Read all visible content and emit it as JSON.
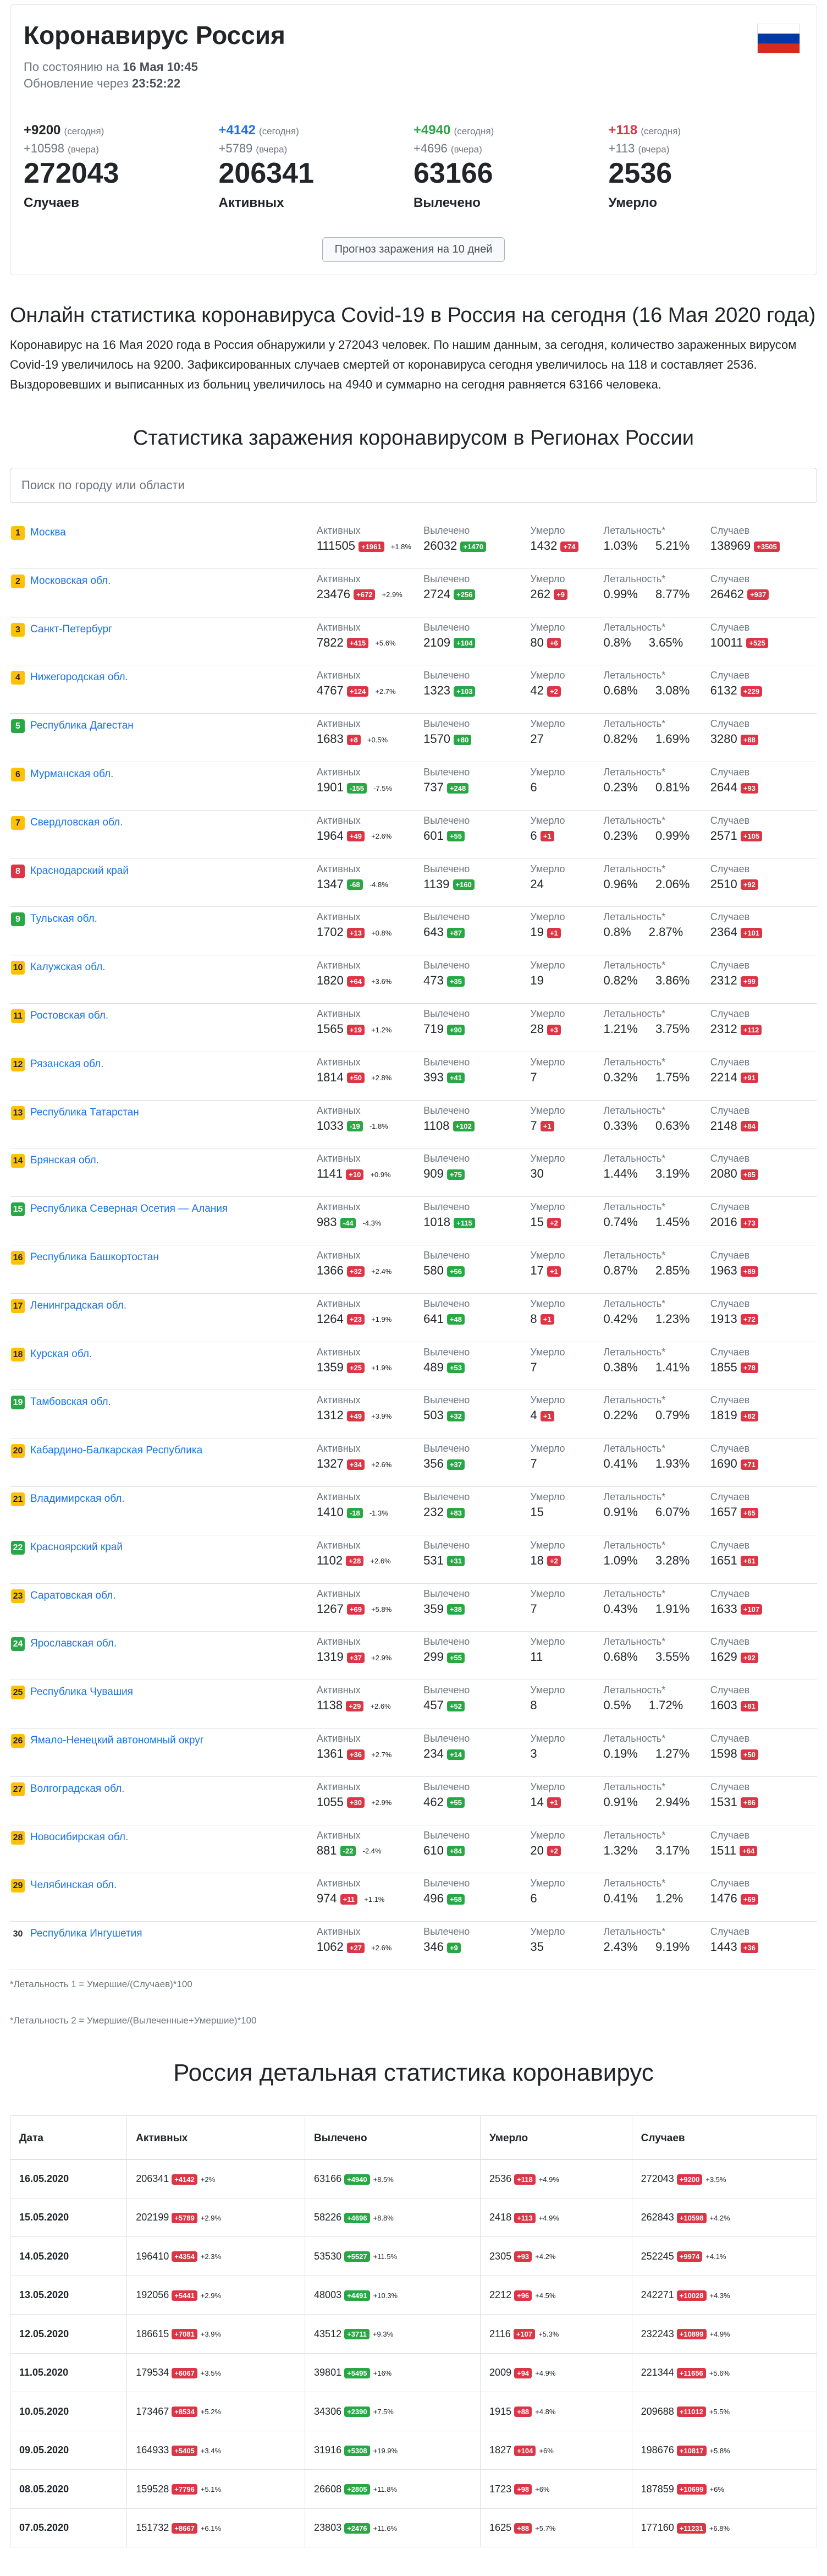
{
  "header": {
    "title": "Коронавирус Россия",
    "as_of_prefix": "По состоянию на",
    "as_of_value": "16 Мая 10:45",
    "update_prefix": "Обновление через",
    "update_value": "23:52:22"
  },
  "summary": [
    {
      "today": "+9200",
      "today_note": "(сегодня)",
      "yest": "+10598",
      "yest_note": "(вчера)",
      "total": "272043",
      "label": "Случаев",
      "color": "#212529"
    },
    {
      "today": "+4142",
      "today_note": "(сегодня)",
      "yest": "+5789",
      "yest_note": "(вчера)",
      "total": "206341",
      "label": "Активных",
      "color": "#1a73e8"
    },
    {
      "today": "+4940",
      "today_note": "(сегодня)",
      "yest": "+4696",
      "yest_note": "(вчера)",
      "total": "63166",
      "label": "Вылечено",
      "color": "#28a745"
    },
    {
      "today": "+118",
      "today_note": "(сегодня)",
      "yest": "+113",
      "yest_note": "(вчера)",
      "total": "2536",
      "label": "Умерло",
      "color": "#dc3545"
    }
  ],
  "forecast_button": "Прогноз заражения на 10 дней",
  "online_title": "Онлайн статистика коронавируса Covid-19 в Россия на сегодня (16 Мая 2020 года)",
  "online_desc": "Коронавирус на 16 Мая 2020 года в Россия обнаружили у 272043 человек. По нашим данным, за сегодня, количество зараженных вирусом Covid-19 увеличилось на 9200. Зафиксированных случаев смертей от коронавируса сегодня увеличилось на 118 и составляет 2536. Выздоровевших и выписанных из больниц увеличилось на 4940 и суммарно на сегодня равняется 63166 человека.",
  "regions_title": "Статистика заражения коронавирусом в Регионах России",
  "search_placeholder": "Поиск по городу или области",
  "col_labels": {
    "active": "Активных",
    "recovered": "Вылечено",
    "died": "Умерло",
    "lethality": "Летальность*",
    "cases": "Случаев"
  },
  "regions": [
    {
      "rank": "1",
      "rc": "y",
      "name": "Москва",
      "active": "111505",
      "ad": "+1961",
      "ap": "+1.8%",
      "rec": "26032",
      "recd": "+1470",
      "died": "1432",
      "dd": "+74",
      "l1": "1.03%",
      "l2": "5.21%",
      "cases": "138969",
      "cd": "+3505"
    },
    {
      "rank": "2",
      "rc": "y",
      "name": "Московская обл.",
      "active": "23476",
      "ad": "+672",
      "ap": "+2.9%",
      "rec": "2724",
      "recd": "+256",
      "died": "262",
      "dd": "+9",
      "l1": "0.99%",
      "l2": "8.77%",
      "cases": "26462",
      "cd": "+937"
    },
    {
      "rank": "3",
      "rc": "y",
      "name": "Санкт-Петербург",
      "active": "7822",
      "ad": "+415",
      "ap": "+5.6%",
      "rec": "2109",
      "recd": "+104",
      "died": "80",
      "dd": "+6",
      "l1": "0.8%",
      "l2": "3.65%",
      "cases": "10011",
      "cd": "+525"
    },
    {
      "rank": "4",
      "rc": "y",
      "name": "Нижегородская обл.",
      "active": "4767",
      "ad": "+124",
      "ap": "+2.7%",
      "rec": "1323",
      "recd": "+103",
      "died": "42",
      "dd": "+2",
      "l1": "0.68%",
      "l2": "3.08%",
      "cases": "6132",
      "cd": "+229"
    },
    {
      "rank": "5",
      "rc": "g",
      "name": "Республика Дагестан",
      "active": "1683",
      "ad": "+8",
      "ap": "+0.5%",
      "rec": "1570",
      "recd": "+80",
      "died": "27",
      "dd": "",
      "l1": "0.82%",
      "l2": "1.69%",
      "cases": "3280",
      "cd": "+88"
    },
    {
      "rank": "6",
      "rc": "y",
      "name": "Мурманская обл.",
      "active": "1901",
      "ad": "-155",
      "ap": "-7.5%",
      "rec": "737",
      "recd": "+248",
      "died": "6",
      "dd": "",
      "l1": "0.23%",
      "l2": "0.81%",
      "cases": "2644",
      "cd": "+93"
    },
    {
      "rank": "7",
      "rc": "y",
      "name": "Свердловская обл.",
      "active": "1964",
      "ad": "+49",
      "ap": "+2.6%",
      "rec": "601",
      "recd": "+55",
      "died": "6",
      "dd": "+1",
      "l1": "0.23%",
      "l2": "0.99%",
      "cases": "2571",
      "cd": "+105"
    },
    {
      "rank": "8",
      "rc": "r",
      "name": "Краснодарский край",
      "active": "1347",
      "ad": "-68",
      "ap": "-4.8%",
      "rec": "1139",
      "recd": "+160",
      "died": "24",
      "dd": "",
      "l1": "0.96%",
      "l2": "2.06%",
      "cases": "2510",
      "cd": "+92"
    },
    {
      "rank": "9",
      "rc": "g",
      "name": "Тульская обл.",
      "active": "1702",
      "ad": "+13",
      "ap": "+0.8%",
      "rec": "643",
      "recd": "+87",
      "died": "19",
      "dd": "+1",
      "l1": "0.8%",
      "l2": "2.87%",
      "cases": "2364",
      "cd": "+101"
    },
    {
      "rank": "10",
      "rc": "y",
      "name": "Калужская обл.",
      "active": "1820",
      "ad": "+64",
      "ap": "+3.6%",
      "rec": "473",
      "recd": "+35",
      "died": "19",
      "dd": "",
      "l1": "0.82%",
      "l2": "3.86%",
      "cases": "2312",
      "cd": "+99"
    },
    {
      "rank": "11",
      "rc": "y",
      "name": "Ростовская обл.",
      "active": "1565",
      "ad": "+19",
      "ap": "+1.2%",
      "rec": "719",
      "recd": "+90",
      "died": "28",
      "dd": "+3",
      "l1": "1.21%",
      "l2": "3.75%",
      "cases": "2312",
      "cd": "+112"
    },
    {
      "rank": "12",
      "rc": "y",
      "name": "Рязанская обл.",
      "active": "1814",
      "ad": "+50",
      "ap": "+2.8%",
      "rec": "393",
      "recd": "+41",
      "died": "7",
      "dd": "",
      "l1": "0.32%",
      "l2": "1.75%",
      "cases": "2214",
      "cd": "+91"
    },
    {
      "rank": "13",
      "rc": "y",
      "name": "Республика Татарстан",
      "active": "1033",
      "ad": "-19",
      "ap": "-1.8%",
      "rec": "1108",
      "recd": "+102",
      "died": "7",
      "dd": "+1",
      "l1": "0.33%",
      "l2": "0.63%",
      "cases": "2148",
      "cd": "+84"
    },
    {
      "rank": "14",
      "rc": "y",
      "name": "Брянская обл.",
      "active": "1141",
      "ad": "+10",
      "ap": "+0.9%",
      "rec": "909",
      "recd": "+75",
      "died": "30",
      "dd": "",
      "l1": "1.44%",
      "l2": "3.19%",
      "cases": "2080",
      "cd": "+85"
    },
    {
      "rank": "15",
      "rc": "g",
      "name": "Республика Северная Осетия — Алания",
      "active": "983",
      "ad": "-44",
      "ap": "-4.3%",
      "rec": "1018",
      "recd": "+115",
      "died": "15",
      "dd": "+2",
      "l1": "0.74%",
      "l2": "1.45%",
      "cases": "2016",
      "cd": "+73"
    },
    {
      "rank": "16",
      "rc": "y",
      "name": "Республика Башкортостан",
      "active": "1366",
      "ad": "+32",
      "ap": "+2.4%",
      "rec": "580",
      "recd": "+56",
      "died": "17",
      "dd": "+1",
      "l1": "0.87%",
      "l2": "2.85%",
      "cases": "1963",
      "cd": "+89"
    },
    {
      "rank": "17",
      "rc": "y",
      "name": "Ленинградская обл.",
      "active": "1264",
      "ad": "+23",
      "ap": "+1.9%",
      "rec": "641",
      "recd": "+48",
      "died": "8",
      "dd": "+1",
      "l1": "0.42%",
      "l2": "1.23%",
      "cases": "1913",
      "cd": "+72"
    },
    {
      "rank": "18",
      "rc": "y",
      "name": "Курская обл.",
      "active": "1359",
      "ad": "+25",
      "ap": "+1.9%",
      "rec": "489",
      "recd": "+53",
      "died": "7",
      "dd": "",
      "l1": "0.38%",
      "l2": "1.41%",
      "cases": "1855",
      "cd": "+78"
    },
    {
      "rank": "19",
      "rc": "g",
      "name": "Тамбовская обл.",
      "active": "1312",
      "ad": "+49",
      "ap": "+3.9%",
      "rec": "503",
      "recd": "+32",
      "died": "4",
      "dd": "+1",
      "l1": "0.22%",
      "l2": "0.79%",
      "cases": "1819",
      "cd": "+82"
    },
    {
      "rank": "20",
      "rc": "y",
      "name": "Кабардино-Балкарская Республика",
      "active": "1327",
      "ad": "+34",
      "ap": "+2.6%",
      "rec": "356",
      "recd": "+37",
      "died": "7",
      "dd": "",
      "l1": "0.41%",
      "l2": "1.93%",
      "cases": "1690",
      "cd": "+71"
    },
    {
      "rank": "21",
      "rc": "y",
      "name": "Владимирская обл.",
      "active": "1410",
      "ad": "-18",
      "ap": "-1.3%",
      "rec": "232",
      "recd": "+83",
      "died": "15",
      "dd": "",
      "l1": "0.91%",
      "l2": "6.07%",
      "cases": "1657",
      "cd": "+65"
    },
    {
      "rank": "22",
      "rc": "g",
      "name": "Красноярский край",
      "active": "1102",
      "ad": "+28",
      "ap": "+2.6%",
      "rec": "531",
      "recd": "+31",
      "died": "18",
      "dd": "+2",
      "l1": "1.09%",
      "l2": "3.28%",
      "cases": "1651",
      "cd": "+61"
    },
    {
      "rank": "23",
      "rc": "y",
      "name": "Саратовская обл.",
      "active": "1267",
      "ad": "+69",
      "ap": "+5.8%",
      "rec": "359",
      "recd": "+38",
      "died": "7",
      "dd": "",
      "l1": "0.43%",
      "l2": "1.91%",
      "cases": "1633",
      "cd": "+107"
    },
    {
      "rank": "24",
      "rc": "g",
      "name": "Ярославская обл.",
      "active": "1319",
      "ad": "+37",
      "ap": "+2.9%",
      "rec": "299",
      "recd": "+55",
      "died": "11",
      "dd": "",
      "l1": "0.68%",
      "l2": "3.55%",
      "cases": "1629",
      "cd": "+92"
    },
    {
      "rank": "25",
      "rc": "y",
      "name": "Республика Чувашия",
      "active": "1138",
      "ad": "+29",
      "ap": "+2.6%",
      "rec": "457",
      "recd": "+52",
      "died": "8",
      "dd": "",
      "l1": "0.5%",
      "l2": "1.72%",
      "cases": "1603",
      "cd": "+81"
    },
    {
      "rank": "26",
      "rc": "y",
      "name": "Ямало-Ненецкий автономный округ",
      "active": "1361",
      "ad": "+36",
      "ap": "+2.7%",
      "rec": "234",
      "recd": "+14",
      "died": "3",
      "dd": "",
      "l1": "0.19%",
      "l2": "1.27%",
      "cases": "1598",
      "cd": "+50"
    },
    {
      "rank": "27",
      "rc": "y",
      "name": "Волгоградская обл.",
      "active": "1055",
      "ad": "+30",
      "ap": "+2.9%",
      "rec": "462",
      "recd": "+55",
      "died": "14",
      "dd": "+1",
      "l1": "0.91%",
      "l2": "2.94%",
      "cases": "1531",
      "cd": "+86"
    },
    {
      "rank": "28",
      "rc": "y",
      "name": "Новосибирская обл.",
      "active": "881",
      "ad": "-22",
      "ap": "-2.4%",
      "rec": "610",
      "recd": "+84",
      "died": "20",
      "dd": "+2",
      "l1": "1.32%",
      "l2": "3.17%",
      "cases": "1511",
      "cd": "+64"
    },
    {
      "rank": "29",
      "rc": "y",
      "name": "Челябинская обл.",
      "active": "974",
      "ad": "+11",
      "ap": "+1.1%",
      "rec": "496",
      "recd": "+58",
      "died": "6",
      "dd": "",
      "l1": "0.41%",
      "l2": "1.2%",
      "cases": "1476",
      "cd": "+69"
    },
    {
      "rank": "30",
      "rc": "n",
      "name": "Республика Ингушетия",
      "active": "1062",
      "ad": "+27",
      "ap": "+2.6%",
      "rec": "346",
      "recd": "+9",
      "died": "35",
      "dd": "",
      "l1": "2.43%",
      "l2": "9.19%",
      "cases": "1443",
      "cd": "+36"
    }
  ],
  "note1": "*Летальность 1 = Умершие/(Случаев)*100",
  "note2": "*Летальность 2 = Умершие/(Вылеченные+Умершие)*100",
  "detail_title": "Россия детальная статистика коронавирус",
  "detail_headers": [
    "Дата",
    "Активных",
    "Вылечено",
    "Умерло",
    "Случаев"
  ],
  "detail_rows": [
    {
      "date": "16.05.2020",
      "active": "206341",
      "ad": "+4142",
      "ap": "+2%",
      "rec": "63166",
      "recd": "+4940",
      "recp": "+8.5%",
      "died": "2536",
      "dd": "+118",
      "dp": "+4.9%",
      "cases": "272043",
      "cd": "+9200",
      "cp": "+3.5%"
    },
    {
      "date": "15.05.2020",
      "active": "202199",
      "ad": "+5789",
      "ap": "+2.9%",
      "rec": "58226",
      "recd": "+4696",
      "recp": "+8.8%",
      "died": "2418",
      "dd": "+113",
      "dp": "+4.9%",
      "cases": "262843",
      "cd": "+10598",
      "cp": "+4.2%"
    },
    {
      "date": "14.05.2020",
      "active": "196410",
      "ad": "+4354",
      "ap": "+2.3%",
      "rec": "53530",
      "recd": "+5527",
      "recp": "+11.5%",
      "died": "2305",
      "dd": "+93",
      "dp": "+4.2%",
      "cases": "252245",
      "cd": "+9974",
      "cp": "+4.1%"
    },
    {
      "date": "13.05.2020",
      "active": "192056",
      "ad": "+5441",
      "ap": "+2.9%",
      "rec": "48003",
      "recd": "+4491",
      "recp": "+10.3%",
      "died": "2212",
      "dd": "+96",
      "dp": "+4.5%",
      "cases": "242271",
      "cd": "+10028",
      "cp": "+4.3%"
    },
    {
      "date": "12.05.2020",
      "active": "186615",
      "ad": "+7081",
      "ap": "+3.9%",
      "rec": "43512",
      "recd": "+3711",
      "recp": "+9.3%",
      "died": "2116",
      "dd": "+107",
      "dp": "+5.3%",
      "cases": "232243",
      "cd": "+10899",
      "cp": "+4.9%"
    },
    {
      "date": "11.05.2020",
      "active": "179534",
      "ad": "+6067",
      "ap": "+3.5%",
      "rec": "39801",
      "recd": "+5495",
      "recp": "+16%",
      "died": "2009",
      "dd": "+94",
      "dp": "+4.9%",
      "cases": "221344",
      "cd": "+11656",
      "cp": "+5.6%"
    },
    {
      "date": "10.05.2020",
      "active": "173467",
      "ad": "+8534",
      "ap": "+5.2%",
      "rec": "34306",
      "recd": "+2390",
      "recp": "+7.5%",
      "died": "1915",
      "dd": "+88",
      "dp": "+4.8%",
      "cases": "209688",
      "cd": "+11012",
      "cp": "+5.5%"
    },
    {
      "date": "09.05.2020",
      "active": "164933",
      "ad": "+5405",
      "ap": "+3.4%",
      "rec": "31916",
      "recd": "+5308",
      "recp": "+19.9%",
      "died": "1827",
      "dd": "+104",
      "dp": "+6%",
      "cases": "198676",
      "cd": "+10817",
      "cp": "+5.8%"
    },
    {
      "date": "08.05.2020",
      "active": "159528",
      "ad": "+7796",
      "ap": "+5.1%",
      "rec": "26608",
      "recd": "+2805",
      "recp": "+11.8%",
      "died": "1723",
      "dd": "+98",
      "dp": "+6%",
      "cases": "187859",
      "cd": "+10699",
      "cp": "+6%"
    },
    {
      "date": "07.05.2020",
      "active": "151732",
      "ad": "+8667",
      "ap": "+6.1%",
      "rec": "23803",
      "recd": "+2476",
      "recp": "+11.6%",
      "died": "1625",
      "dd": "+88",
      "dp": "+5.7%",
      "cases": "177160",
      "cd": "+11231",
      "cp": "+6.8%"
    }
  ],
  "colors": {
    "red": "#dc3545",
    "green": "#28a745",
    "blue": "#1a73e8",
    "yellow": "#ffc107"
  }
}
